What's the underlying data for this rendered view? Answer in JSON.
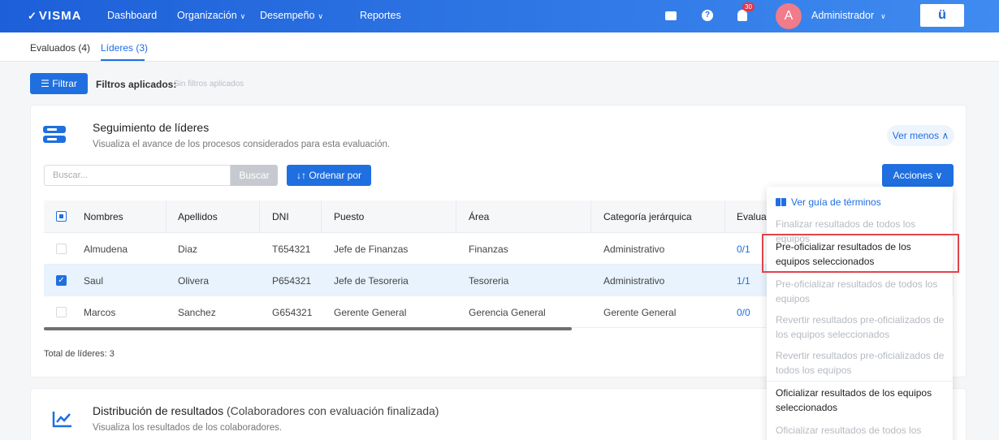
{
  "topbar": {
    "logo": "VISMA",
    "nav": [
      {
        "label": "Dashboard"
      },
      {
        "label": "Organización",
        "dropdown": true
      },
      {
        "label": "Desempeño",
        "dropdown": true
      },
      {
        "label": "Reportes"
      }
    ],
    "notification_count": "30",
    "avatar_initial": "A",
    "user_name": "Administrador",
    "app_icon": "ü"
  },
  "tabs": [
    {
      "label": "Evaluados (4)",
      "active": false
    },
    {
      "label": "Líderes (3)",
      "active": true
    }
  ],
  "filters": {
    "button_label": "Filtrar",
    "applied_label": "Filtros aplicados:",
    "applied_value": "Sin filtros aplicados"
  },
  "leaders_card": {
    "title": "Seguimiento de líderes",
    "subtitle": "Visualiza el avance de los procesos considerados para esta evaluación.",
    "toggle_label": "Ver menos",
    "search_placeholder": "Buscar...",
    "search_button": "Buscar",
    "order_button": "Ordenar por",
    "actions_button": "Acciones",
    "columns": [
      "Nombres",
      "Apellidos",
      "DNI",
      "Puesto",
      "Área",
      "Categoría jerárquica",
      "Evaluac"
    ],
    "rows": [
      {
        "nombres": "Almudena",
        "apellidos": "Diaz",
        "dni": "T654321",
        "puesto": "Jefe de Finanzas",
        "area": "Finanzas",
        "categoria": "Administrativo",
        "evaluados": "0/1",
        "selected": false
      },
      {
        "nombres": "Saul",
        "apellidos": "Olivera",
        "dni": "P654321",
        "puesto": "Jefe de Tesoreria",
        "area": "Tesoreria",
        "categoria": "Administrativo",
        "evaluados": "1/1",
        "selected": true
      },
      {
        "nombres": "Marcos",
        "apellidos": "Sanchez",
        "dni": "G654321",
        "puesto": "Gerente General",
        "area": "Gerencia General",
        "categoria": "Gerente General",
        "evaluados": "0/0",
        "selected": false
      }
    ],
    "total_label": "Total de líderes: 3"
  },
  "results_card": {
    "title": "Distribución de resultados",
    "title_suffix": "(Colaboradores con evaluación finalizada)",
    "subtitle": "Visualiza los resultados de los colaboradores."
  },
  "actions_menu": {
    "guide_label": "Ver guía de términos",
    "items": [
      {
        "label": "Finalizar resultados de todos los equipos",
        "enabled": false
      },
      {
        "label": "Pre-oficializar resultados de los equipos seleccionados",
        "enabled": true
      },
      {
        "label": "Pre-oficializar resultados de todos los equipos",
        "enabled": false
      },
      {
        "label": "Revertir resultados pre-oficializados de los equipos seleccionados",
        "enabled": false
      },
      {
        "label": "Revertir resultados pre-oficializados de todos los equipos",
        "enabled": false
      },
      {
        "label": "Oficializar resultados de los equipos seleccionados",
        "enabled": true
      },
      {
        "label": "Oficializar resultados de todos los",
        "enabled": false
      }
    ]
  },
  "colors": {
    "primary": "#1f6fe0",
    "selected_row": "#e8f3fd",
    "highlight": "#e0444a"
  }
}
